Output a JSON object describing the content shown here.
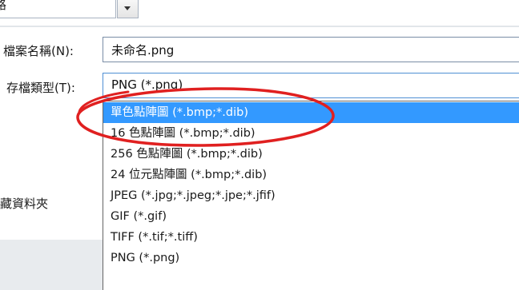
{
  "top": {
    "field_text": "路"
  },
  "filename": {
    "label": "檔案名稱(N):",
    "value": "未命名.png"
  },
  "filetype": {
    "label": "存檔類型(T):",
    "value": "PNG (*.png)",
    "options": [
      "單色點陣圖 (*.bmp;*.dib)",
      "16 色點陣圖 (*.bmp;*.dib)",
      "256 色點陣圖 (*.bmp;*.dib)",
      "24 位元點陣圖 (*.bmp;*.dib)",
      "JPEG (*.jpg;*.jpeg;*.jpe;*.jfif)",
      "GIF (*.gif)",
      "TIFF (*.tif;*.tiff)",
      "PNG (*.png)"
    ],
    "highlighted_option": "單色點陣圖 (*.bmp;*.dib)"
  },
  "folder": {
    "label": "藏資料夾"
  },
  "colors": {
    "selection": "#3399ff",
    "annotation_ellipse": "#e02020"
  }
}
